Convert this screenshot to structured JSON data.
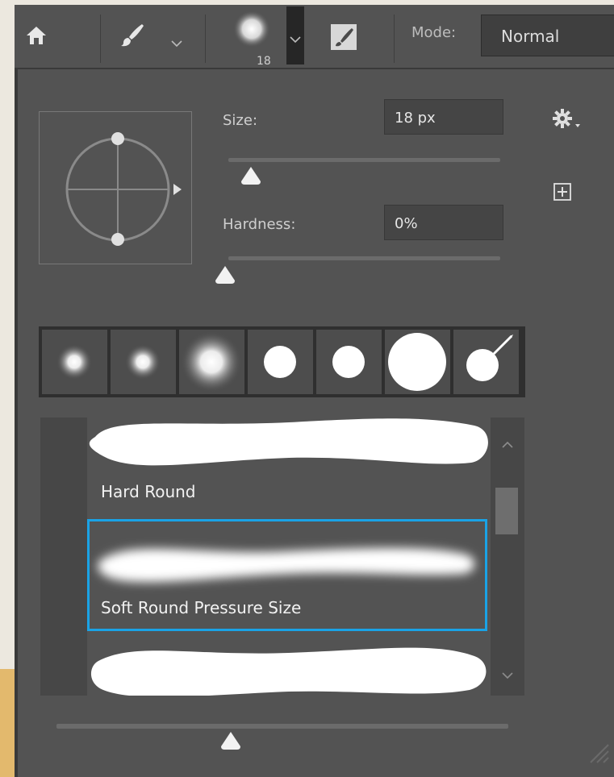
{
  "toolbar": {
    "brush_size_value": "18",
    "mode_label": "Mode:",
    "mode_value": "Normal"
  },
  "brush_panel": {
    "size_label": "Size:",
    "size_value": "18 px",
    "hardness_label": "Hardness:",
    "hardness_value": "0%",
    "size_slider_level": 0.09,
    "hardness_slider_level": 0.0
  },
  "brush_list": {
    "items": [
      {
        "name": "Hard Round",
        "selected": false
      },
      {
        "name": "Soft Round Pressure Size",
        "selected": true
      },
      {
        "name": "",
        "selected": false
      }
    ]
  },
  "preview_slider_level": 0.39,
  "colors": {
    "accent": "#1aa3e6",
    "panel_bg": "#535353",
    "field_bg": "#454545"
  },
  "icons": [
    "home-icon",
    "brush-tool-icon",
    "chevron-down-icon",
    "brush-preset-picker-icon",
    "toggle-brush-settings-icon",
    "gear-icon",
    "new-preset-icon",
    "scroll-up-icon",
    "scroll-down-icon",
    "resize-grip-icon"
  ]
}
